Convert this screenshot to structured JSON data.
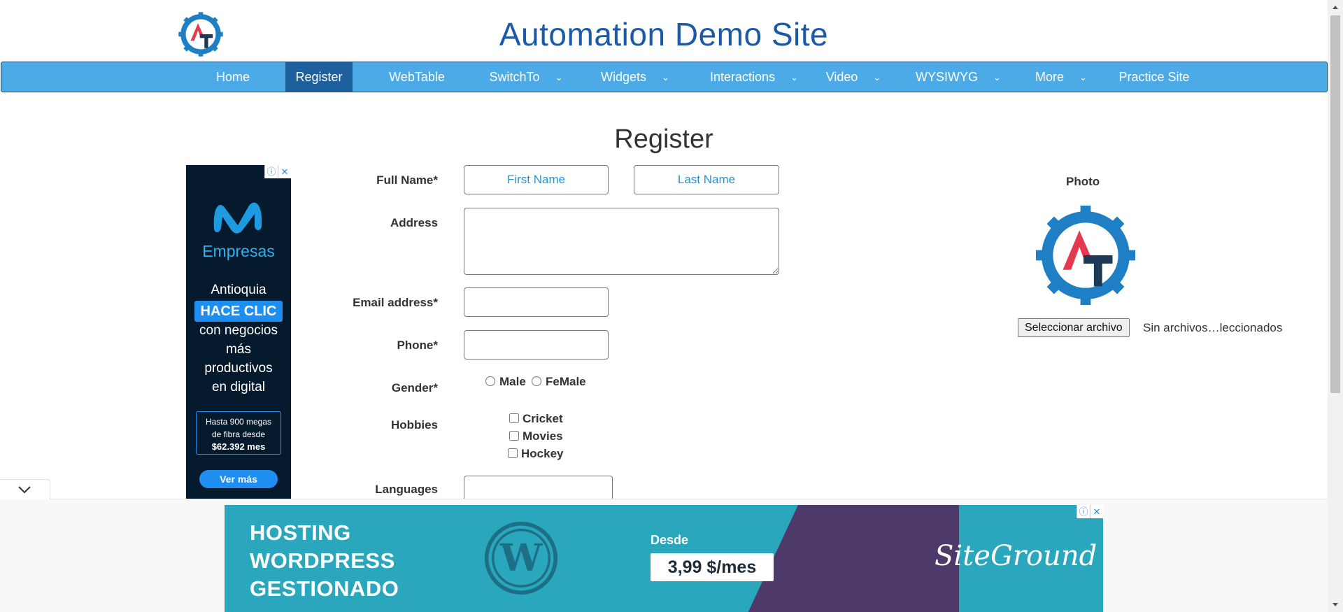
{
  "header": {
    "site_title": "Automation Demo Site"
  },
  "navbar": {
    "items": [
      {
        "label": "Home"
      },
      {
        "label": "Register"
      },
      {
        "label": "WebTable"
      },
      {
        "label": "SwitchTo"
      },
      {
        "label": "Widgets"
      },
      {
        "label": "Interactions"
      },
      {
        "label": "Video"
      },
      {
        "label": "WYSIWYG"
      },
      {
        "label": "More"
      },
      {
        "label": "Practice Site"
      }
    ],
    "active": "Register",
    "caret": "⌄"
  },
  "form": {
    "heading": "Register",
    "full_name_label": "Full Name*",
    "first_name_placeholder": "First Name",
    "last_name_placeholder": "Last Name",
    "address_label": "Address",
    "email_label": "Email address*",
    "phone_label": "Phone*",
    "gender_label": "Gender*",
    "gender_options": [
      "Male",
      "FeMale"
    ],
    "hobbies_label": "Hobbies",
    "hobbies_options": [
      "Cricket",
      "Movies",
      "Hockey"
    ],
    "languages_label": "Languages"
  },
  "photo": {
    "label": "Photo",
    "file_button": "Seleccionar archivo",
    "file_status": "Sin archivos…leccionados"
  },
  "ad_left": {
    "brand": "Empresas",
    "line1": "Antioquia",
    "highlight": "HACE CLIC",
    "line2": "con negocios",
    "line3": "más",
    "line4": "productivos",
    "line5": "en digital",
    "offer_line1": "Hasta 900 megas",
    "offer_line2": "de fibra desde",
    "offer_price": "$62.392 mes",
    "cta": "Ver más"
  },
  "ad_bottom": {
    "line1": "HOSTING",
    "line2": "WORDPRESS",
    "line3": "GESTIONADO",
    "desde": "Desde",
    "price": "3,99 $/mes",
    "brand": "SiteGround"
  },
  "colors": {
    "nav_bg": "#4cabe6",
    "nav_active": "#1e5f9e",
    "title": "#1c5aa6",
    "placeholder": "#2196d3"
  }
}
